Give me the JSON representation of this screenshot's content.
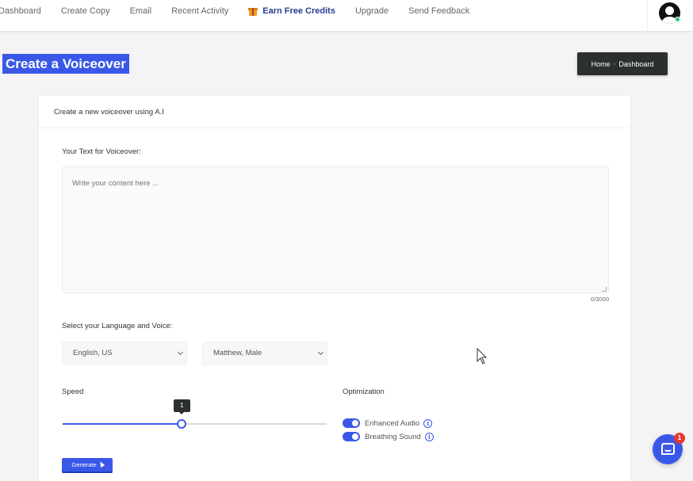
{
  "nav": {
    "links": [
      "Dashboard",
      "Create Copy",
      "Email",
      "Recent Activity",
      "Earn Free Credits",
      "Upgrade",
      "Send Feedback"
    ]
  },
  "page": {
    "title": "Create a Voiceover",
    "breadcrumb": [
      "Home",
      "Dashboard"
    ]
  },
  "card": {
    "header": "Create a new voiceover using A.I",
    "text_label": "Your Text for Voiceover:",
    "text_placeholder": "Write your content here ...",
    "char_counter": "0/3000",
    "voice_label": "Select your Language and Voice:",
    "language_value": "English, US",
    "voice_value": "Matthew, Male",
    "speed_label": "Speed",
    "speed_value": "1",
    "speed_fraction": 0.45,
    "optimization_label": "Optimization",
    "toggles": [
      {
        "label": "Enhanced Audio",
        "on": true
      },
      {
        "label": "Breathing Sound",
        "on": true
      }
    ],
    "generate_label": "Generate"
  },
  "chat": {
    "unread": "1"
  },
  "colors": {
    "accent": "#3a58e8",
    "dark": "#2b2f2e",
    "online": "#28c76f"
  }
}
